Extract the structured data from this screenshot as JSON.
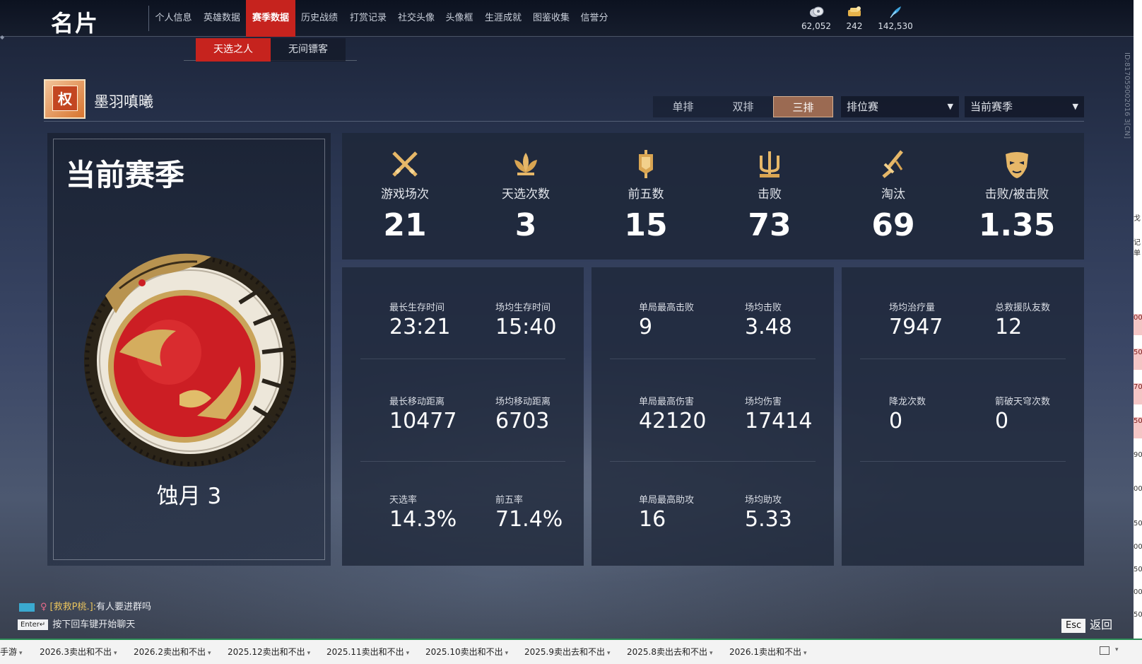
{
  "header": {
    "title": "名片",
    "nav_tabs": [
      {
        "label": "个人信息",
        "active": false
      },
      {
        "label": "英雄数据",
        "active": false
      },
      {
        "label": "赛季数据",
        "active": true
      },
      {
        "label": "历史战绩",
        "active": false
      },
      {
        "label": "打赏记录",
        "active": false
      },
      {
        "label": "社交头像",
        "active": false
      },
      {
        "label": "头像框",
        "active": false
      },
      {
        "label": "生涯成就",
        "active": false
      },
      {
        "label": "图鉴收集",
        "active": false
      },
      {
        "label": "信誉分",
        "active": false
      }
    ],
    "currencies": [
      {
        "icon": "jade-coin-icon",
        "value": "62,052"
      },
      {
        "icon": "gold-ticket-icon",
        "value": "242"
      },
      {
        "icon": "blue-feather-icon",
        "value": "142,530"
      }
    ]
  },
  "subtabs": [
    {
      "label": "天选之人",
      "active": true
    },
    {
      "label": "无间镖客",
      "active": false
    }
  ],
  "player": {
    "badge_char": "权",
    "name": "墨羽嗔曦"
  },
  "filters": {
    "modes": [
      {
        "label": "单排",
        "active": false
      },
      {
        "label": "双排",
        "active": false
      },
      {
        "label": "三排",
        "active": true
      }
    ],
    "match_type": "排位赛",
    "season": "当前赛季"
  },
  "season_card": {
    "title": "当前赛季",
    "rank_emblem": "dragon-ring-emblem-icon",
    "rank_name": "蚀月 3"
  },
  "summary": [
    {
      "icon": "crossed-swords-icon",
      "label": "游戏场次",
      "value": "21"
    },
    {
      "icon": "lotus-icon",
      "label": "天选次数",
      "value": "3"
    },
    {
      "icon": "banner-icon",
      "label": "前五数",
      "value": "15"
    },
    {
      "icon": "trident-icon",
      "label": "击败",
      "value": "73"
    },
    {
      "icon": "broken-sword-icon",
      "label": "淘汰",
      "value": "69"
    },
    {
      "icon": "mask-icon",
      "label": "击败/被击败",
      "value": "1.35"
    }
  ],
  "panels": [
    {
      "rows": [
        [
          {
            "label": "最长生存时间",
            "value": "23:21"
          },
          {
            "label": "场均生存时间",
            "value": "15:40"
          }
        ],
        [
          {
            "label": "最长移动距离",
            "value": "10477"
          },
          {
            "label": "场均移动距离",
            "value": "6703"
          }
        ],
        [
          {
            "label": "天选率",
            "value": "14.3%"
          },
          {
            "label": "前五率",
            "value": "71.4%"
          }
        ]
      ]
    },
    {
      "rows": [
        [
          {
            "label": "单局最高击败",
            "value": "9"
          },
          {
            "label": "场均击败",
            "value": "3.48"
          }
        ],
        [
          {
            "label": "单局最高伤害",
            "value": "42120"
          },
          {
            "label": "场均伤害",
            "value": "17414"
          }
        ],
        [
          {
            "label": "单局最高助攻",
            "value": "16"
          },
          {
            "label": "场均助攻",
            "value": "5.33"
          }
        ]
      ]
    },
    {
      "rows": [
        [
          {
            "label": "场均治疗量",
            "value": "7947"
          },
          {
            "label": "总救援队友数",
            "value": "12"
          }
        ],
        [
          {
            "label": "降龙次数",
            "value": "0"
          },
          {
            "label": "箭破天穹次数",
            "value": "0"
          }
        ]
      ]
    }
  ],
  "chat": {
    "channel": "[救救P桃.]:",
    "message": "有人要进群吗",
    "enter_key": "Enter↵",
    "enter_hint": "按下回车键开始聊天"
  },
  "esc": {
    "key": "Esc",
    "label": "返回"
  },
  "player_id": "ID:817059002016 3[CN]",
  "sheet_right_cells": [
    "戈",
    "记单",
    "00'",
    "50'",
    "70'",
    "50'",
    "90'",
    "00'",
    "50'",
    "00'",
    "50'",
    "00'",
    "50'"
  ],
  "sheet_tabs": [
    "手游",
    "2026.3卖出和不出",
    "2026.2卖出和不出",
    "2025.12卖出和不出",
    "2025.11卖出和不出",
    "2025.10卖出和不出",
    "2025.9卖出去和不出",
    "2025.8卖出去和不出",
    "2026.1卖出和不出"
  ]
}
